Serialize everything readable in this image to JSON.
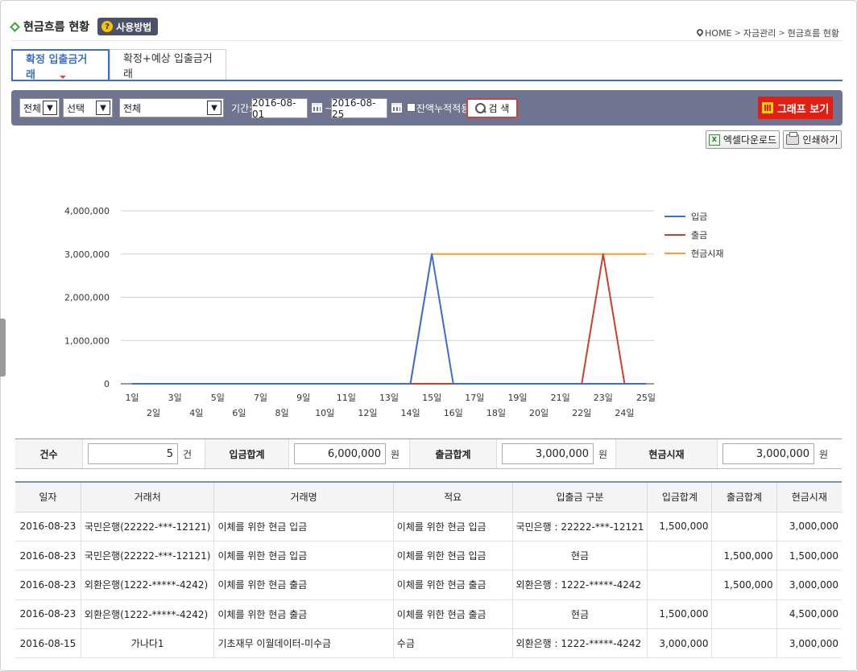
{
  "header": {
    "title": "현금흐름 현황",
    "help_label": "사용방법",
    "breadcrumb": [
      "HOME",
      "자금관리",
      "현금흐름 현황"
    ]
  },
  "tabs": [
    {
      "label": "확정 입출금거래",
      "active": true
    },
    {
      "label": "확정+예상 입출금거래",
      "active": false
    }
  ],
  "filter": {
    "select1": "전체",
    "select2": "선택",
    "select3": "전체",
    "period_label": "기간:",
    "date_from": "2016-08-01",
    "tilde": "~",
    "date_to": "2016-08-25",
    "cumulative_label": "잔액누적적용",
    "cumulative_checked": false,
    "search_label": "검 색",
    "graph_label": "그래프 보기"
  },
  "tools": {
    "excel_label": "엑셀다운로드",
    "print_label": "인쇄하기"
  },
  "colors": {
    "accent": "#3d6fc4",
    "filter_bg": "#6f7590",
    "graph_btn": "#e21d12",
    "in_series": "#3a6fcf",
    "out_series": "#c9402c",
    "cash_series": "#f0a030"
  },
  "chart_data": {
    "type": "line",
    "x": [
      "1일",
      "2일",
      "3일",
      "4일",
      "5일",
      "6일",
      "7일",
      "8일",
      "9일",
      "10일",
      "11일",
      "12일",
      "13일",
      "14일",
      "15일",
      "16일",
      "17일",
      "18일",
      "19일",
      "20일",
      "21일",
      "22일",
      "23일",
      "24일",
      "25일"
    ],
    "yticks": [
      "0",
      "1,000,000",
      "2,000,000",
      "3,000,000",
      "4,000,000"
    ],
    "ylim": [
      0,
      4000000
    ],
    "grid": true,
    "legend_position": "right",
    "series": [
      {
        "name": "입금",
        "color": "#3a6fcf",
        "values": [
          0,
          0,
          0,
          0,
          0,
          0,
          0,
          0,
          0,
          0,
          0,
          0,
          0,
          0,
          3000000,
          0,
          0,
          0,
          0,
          0,
          0,
          0,
          0,
          0,
          0
        ]
      },
      {
        "name": "출금",
        "color": "#c9402c",
        "values": [
          0,
          0,
          0,
          0,
          0,
          0,
          0,
          0,
          0,
          0,
          0,
          0,
          0,
          0,
          0,
          0,
          0,
          0,
          0,
          0,
          0,
          0,
          3000000,
          0,
          0
        ]
      },
      {
        "name": "현금시재",
        "color": "#f0a030",
        "values": [
          0,
          0,
          0,
          0,
          0,
          0,
          0,
          0,
          0,
          0,
          0,
          0,
          0,
          0,
          3000000,
          3000000,
          3000000,
          3000000,
          3000000,
          3000000,
          3000000,
          3000000,
          3000000,
          3000000,
          3000000
        ]
      }
    ]
  },
  "summary": {
    "count_label": "건수",
    "count_value": "5",
    "count_unit": "건",
    "in_label": "입금합계",
    "in_value": "6,000,000",
    "out_label": "출금합계",
    "out_value": "3,000,000",
    "cash_label": "현금시재",
    "cash_value": "3,000,000",
    "won": "원"
  },
  "table": {
    "headers": [
      "일자",
      "거래처",
      "거래명",
      "적요",
      "입출금 구분",
      "입금합계",
      "출금합계",
      "현금시재"
    ],
    "rows": [
      [
        "2016-08-23",
        "국민은행(22222-***-12121)",
        "이체를 위한 현금 입금",
        "이체를 위한 현금 입금",
        "국민은행 : 22222-***-12121",
        "1,500,000",
        "",
        "3,000,000"
      ],
      [
        "2016-08-23",
        "국민은행(22222-***-12121)",
        "이체를 위한 현금 입금",
        "이체를 위한 현금 입금",
        "현금",
        "",
        "1,500,000",
        "1,500,000"
      ],
      [
        "2016-08-23",
        "외환은행(1222-*****-4242)",
        "이체를 위한 현금 출금",
        "이체를 위한 현금 출금",
        "외환은행 : 1222-*****-4242",
        "",
        "1,500,000",
        "3,000,000"
      ],
      [
        "2016-08-23",
        "외환은행(1222-*****-4242)",
        "이체를 위한 현금 출금",
        "이체를 위한 현금 출금",
        "현금",
        "1,500,000",
        "",
        "4,500,000"
      ],
      [
        "2016-08-15",
        "가나다1",
        "기초재무 이월데이터-미수금",
        "수금",
        "외환은행 : 1222-*****-4242",
        "3,000,000",
        "",
        "3,000,000"
      ]
    ]
  }
}
